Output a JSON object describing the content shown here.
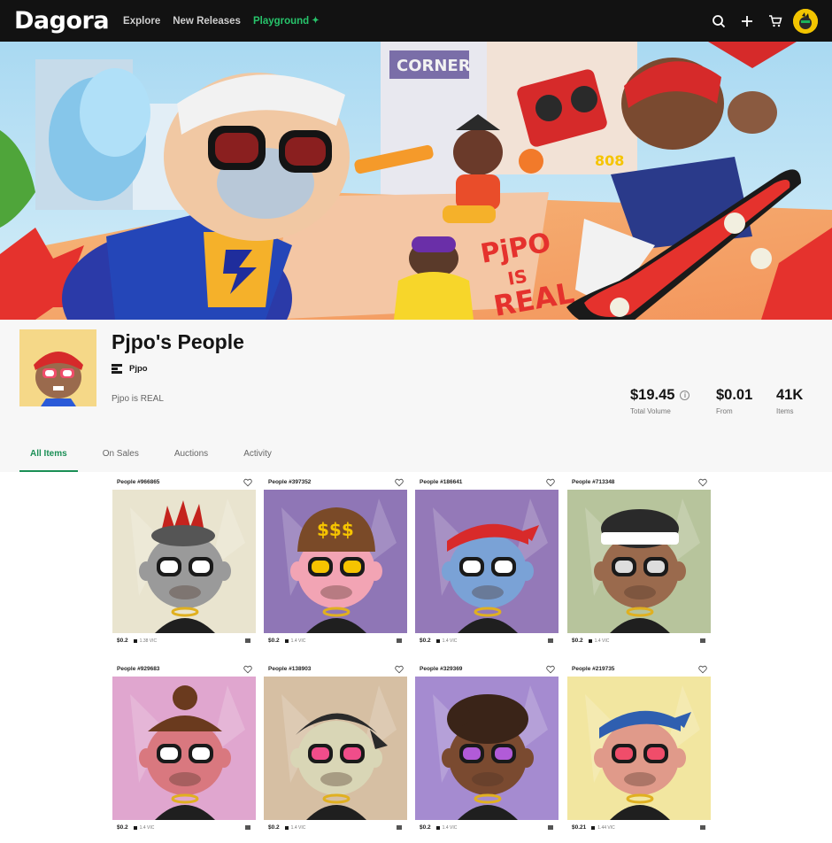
{
  "header": {
    "logo": "Dagora",
    "nav": [
      {
        "label": "Explore"
      },
      {
        "label": "New Releases"
      },
      {
        "label": "Playground"
      }
    ],
    "icons": [
      "search-icon",
      "plus-icon",
      "cart-icon"
    ]
  },
  "banner": {
    "graffiti_text": [
      "PjPO",
      "IS",
      "REAL"
    ],
    "sign_text": "CORNER",
    "chain_text": "808"
  },
  "collection": {
    "title": "Pjpo's People",
    "creator": "Pjpo",
    "description": "Pjpo is REAL",
    "stats": [
      {
        "value": "$19.45",
        "label": "Total Volume",
        "info": true
      },
      {
        "value": "$0.01",
        "label": "From"
      },
      {
        "value": "41K",
        "label": "Items"
      }
    ]
  },
  "tabs": [
    {
      "label": "All Items",
      "active": true
    },
    {
      "label": "On Sales"
    },
    {
      "label": "Auctions"
    },
    {
      "label": "Activity"
    }
  ],
  "items": [
    {
      "name": "People #966865",
      "price": "$0.2",
      "vic": "1.38 VIC",
      "bg": "#e9e4cf",
      "skin": "#9a9a9a",
      "hat": "spikes",
      "hatColor": "#c4231d",
      "glasses": "#ffffff"
    },
    {
      "name": "People #397352",
      "price": "$0.2",
      "vic": "1.4 VIC",
      "bg": "#8f76b6",
      "skin": "#f2a4b4",
      "hat": "cap",
      "hatColor": "#7a4a28",
      "glasses": "#f6c400",
      "capText": "$$$"
    },
    {
      "name": "People #186641",
      "price": "$0.2",
      "vic": "1.4 VIC",
      "bg": "#9479b8",
      "skin": "#7aa2d6",
      "hat": "bandana",
      "hatColor": "#d82a2a",
      "glasses": "#ffffff"
    },
    {
      "name": "People #713348",
      "price": "$0.2",
      "vic": "1.4 VIC",
      "bg": "#b7c49c",
      "skin": "#9a6a4d",
      "hat": "headband",
      "hatColor": "#ffffff",
      "glasses": "#dddddd"
    },
    {
      "name": "People #929683",
      "price": "$0.2",
      "vic": "1.4 VIC",
      "bg": "#e0a6cf",
      "skin": "#d9787f",
      "hat": "bun",
      "hatColor": "#6a3a1e",
      "glasses": "#ffffff"
    },
    {
      "name": "People #138903",
      "price": "$0.2",
      "vic": "1.4 VIC",
      "bg": "#d6bfa3",
      "skin": "#d9d6b6",
      "hat": "durag",
      "hatColor": "#2a2a2a",
      "glasses": "#f04d8a"
    },
    {
      "name": "People #329369",
      "price": "$0.2",
      "vic": "1.4 VIC",
      "bg": "#a58bd0",
      "skin": "#7a4a30",
      "hat": "curls",
      "hatColor": "#3a2418",
      "glasses": "#b15bd8"
    },
    {
      "name": "People #219735",
      "price": "$0.21",
      "vic": "1.44 VIC",
      "bg": "#f2e6a0",
      "skin": "#e09a8a",
      "hat": "bandana",
      "hatColor": "#2f5fb0",
      "glasses": "#f04d6a"
    }
  ]
}
